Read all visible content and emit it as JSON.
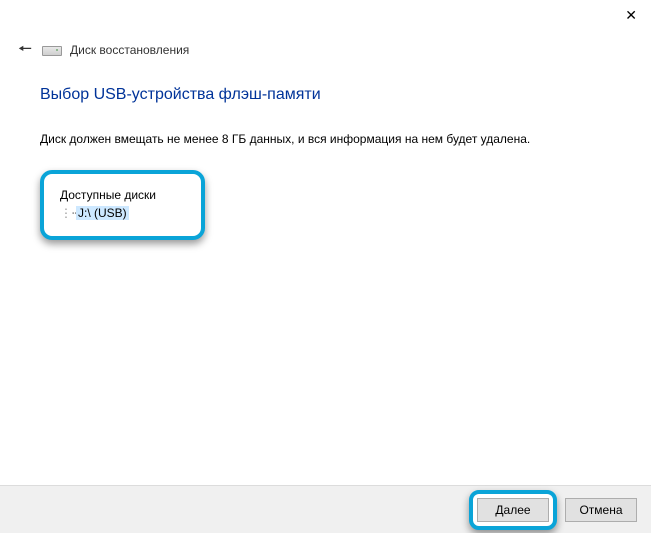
{
  "window": {
    "title": "Диск восстановления"
  },
  "page": {
    "heading": "Выбор USB-устройства флэш-памяти",
    "instruction": "Диск должен вмещать не менее 8 ГБ данных, и вся информация на нем будет удалена."
  },
  "disks": {
    "label": "Доступные диски",
    "items": [
      {
        "label": "J:\\ (USB)"
      }
    ]
  },
  "buttons": {
    "next": "Далее",
    "cancel": "Отмена"
  },
  "icons": {
    "close": "✕",
    "back": "🠔"
  }
}
